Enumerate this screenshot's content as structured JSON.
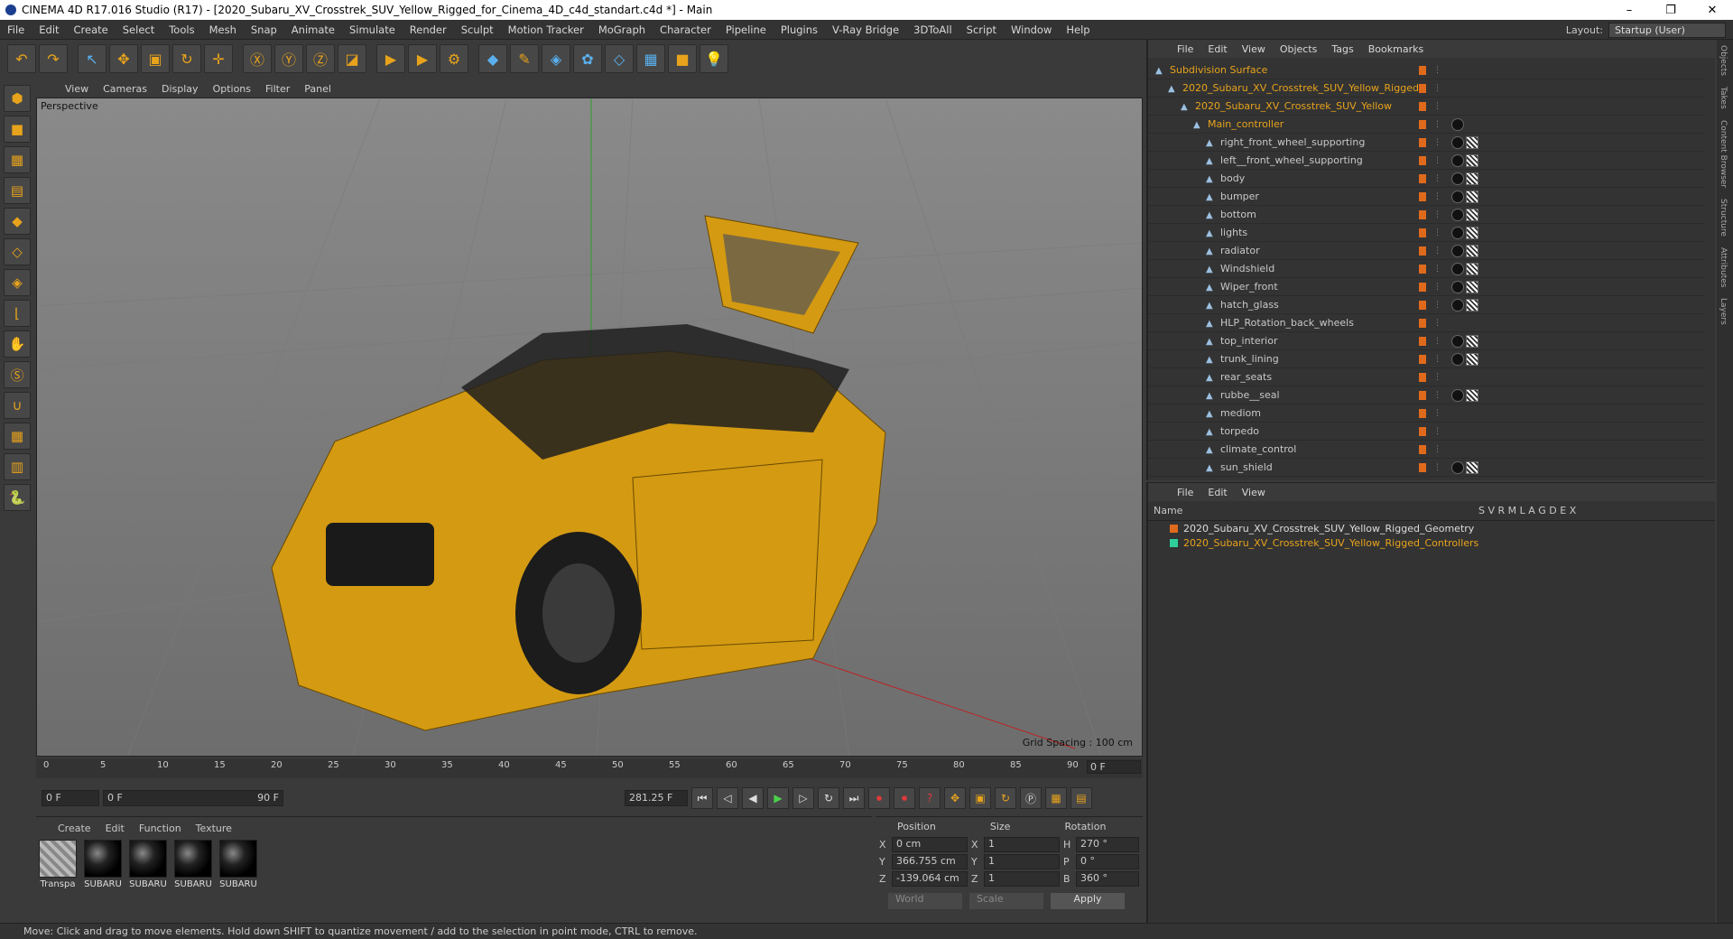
{
  "window": {
    "title": "CINEMA 4D R17.016 Studio (R17) - [2020_Subaru_XV_Crosstrek_SUV_Yellow_Rigged_for_Cinema_4D_c4d_standart.c4d *] - Main",
    "controls": [
      "–",
      "❐",
      "✕"
    ]
  },
  "menu": [
    "File",
    "Edit",
    "Create",
    "Select",
    "Tools",
    "Mesh",
    "Snap",
    "Animate",
    "Simulate",
    "Render",
    "Sculpt",
    "Motion Tracker",
    "MoGraph",
    "Character",
    "Pipeline",
    "Plugins",
    "V-Ray Bridge",
    "3DToAll",
    "Script",
    "Window",
    "Help"
  ],
  "layout": {
    "label": "Layout:",
    "value": "Startup (User)"
  },
  "viewport": {
    "menu": [
      "View",
      "Cameras",
      "Display",
      "Options",
      "Filter",
      "Panel"
    ],
    "camera": "Perspective",
    "grid_spacing": "Grid Spacing : 100 cm"
  },
  "timeline": {
    "ticks": [
      "0",
      "5",
      "10",
      "15",
      "20",
      "25",
      "30",
      "35",
      "40",
      "45",
      "50",
      "55",
      "60",
      "65",
      "70",
      "75",
      "80",
      "85",
      "90"
    ],
    "current": "0 F"
  },
  "transport": {
    "start": "0 F",
    "range_start": "0 F",
    "range_end": "90 F",
    "fps_field": "281.25 F"
  },
  "materials": {
    "menu": [
      "Create",
      "Edit",
      "Function",
      "Texture"
    ],
    "items": [
      "Transpa",
      "SUBARU",
      "SUBARU",
      "SUBARU",
      "SUBARU"
    ]
  },
  "coords": {
    "headers": [
      "Position",
      "Size",
      "Rotation"
    ],
    "rows": [
      {
        "axis": "X",
        "pos": "0 cm",
        "size_axis": "X",
        "size": "1",
        "rot_axis": "H",
        "rot": "270 °"
      },
      {
        "axis": "Y",
        "pos": "366.755 cm",
        "size_axis": "Y",
        "size": "1",
        "rot_axis": "P",
        "rot": "0 °"
      },
      {
        "axis": "Z",
        "pos": "-139.064 cm",
        "size_axis": "Z",
        "size": "1",
        "rot_axis": "B",
        "rot": "360 °"
      }
    ],
    "mode": "World",
    "scale": "Scale",
    "apply": "Apply"
  },
  "status": "Move: Click and drag to move elements. Hold down SHIFT to quantize movement / add to the selection in point mode, CTRL to remove.",
  "objects": {
    "menu": [
      "File",
      "Edit",
      "View",
      "Objects",
      "Tags",
      "Bookmarks"
    ],
    "rows": [
      {
        "name": "Subdivision Surface",
        "orange": true,
        "tags": 0
      },
      {
        "name": "2020_Subaru_XV_Crosstrek_SUV_Yellow_Rigged",
        "orange": true,
        "tags": 0
      },
      {
        "name": "2020_Subaru_XV_Crosstrek_SUV_Yellow",
        "orange": true,
        "tags": 0
      },
      {
        "name": "Main_controller",
        "orange": true,
        "tags": 1
      },
      {
        "name": "right_front_wheel_supporting",
        "orange": false,
        "tags": 2
      },
      {
        "name": "left__front_wheel_supporting",
        "orange": false,
        "tags": 2
      },
      {
        "name": "body",
        "orange": false,
        "tags": 2
      },
      {
        "name": "bumper",
        "orange": false,
        "tags": 2
      },
      {
        "name": "bottom",
        "orange": false,
        "tags": 2
      },
      {
        "name": "lights",
        "orange": false,
        "tags": 2
      },
      {
        "name": "radiator",
        "orange": false,
        "tags": 2
      },
      {
        "name": "Windshield",
        "orange": false,
        "tags": 2
      },
      {
        "name": "Wiper_front",
        "orange": false,
        "tags": 2
      },
      {
        "name": "hatch_glass",
        "orange": false,
        "tags": 2
      },
      {
        "name": "HLP_Rotation_back_wheels",
        "orange": false,
        "tags": 0
      },
      {
        "name": "top_interior",
        "orange": false,
        "tags": 2
      },
      {
        "name": "trunk_lining",
        "orange": false,
        "tags": 2
      },
      {
        "name": "rear_seats",
        "orange": false,
        "tags": 0
      },
      {
        "name": "rubbe__seal",
        "orange": false,
        "tags": 2
      },
      {
        "name": "mediom",
        "orange": false,
        "tags": 0
      },
      {
        "name": "torpedo",
        "orange": false,
        "tags": 0
      },
      {
        "name": "climate_control",
        "orange": false,
        "tags": 0
      },
      {
        "name": "sun_shield",
        "orange": false,
        "tags": 2
      }
    ]
  },
  "layers": {
    "menu": [
      "File",
      "Edit",
      "View"
    ],
    "header_name": "Name",
    "header_flags": "S V R M L A G D E X",
    "rows": [
      {
        "name": "2020_Subaru_XV_Crosstrek_SUV_Yellow_Rigged_Geometry",
        "color": "#e06a1c",
        "orange": false
      },
      {
        "name": "2020_Subaru_XV_Crosstrek_SUV_Yellow_Rigged_Controllers",
        "color": "#2ecf9a",
        "orange": true
      }
    ]
  },
  "side_tabs": [
    "Objects",
    "Takes",
    "Content Browser",
    "Structure",
    "Attributes",
    "Layers"
  ]
}
